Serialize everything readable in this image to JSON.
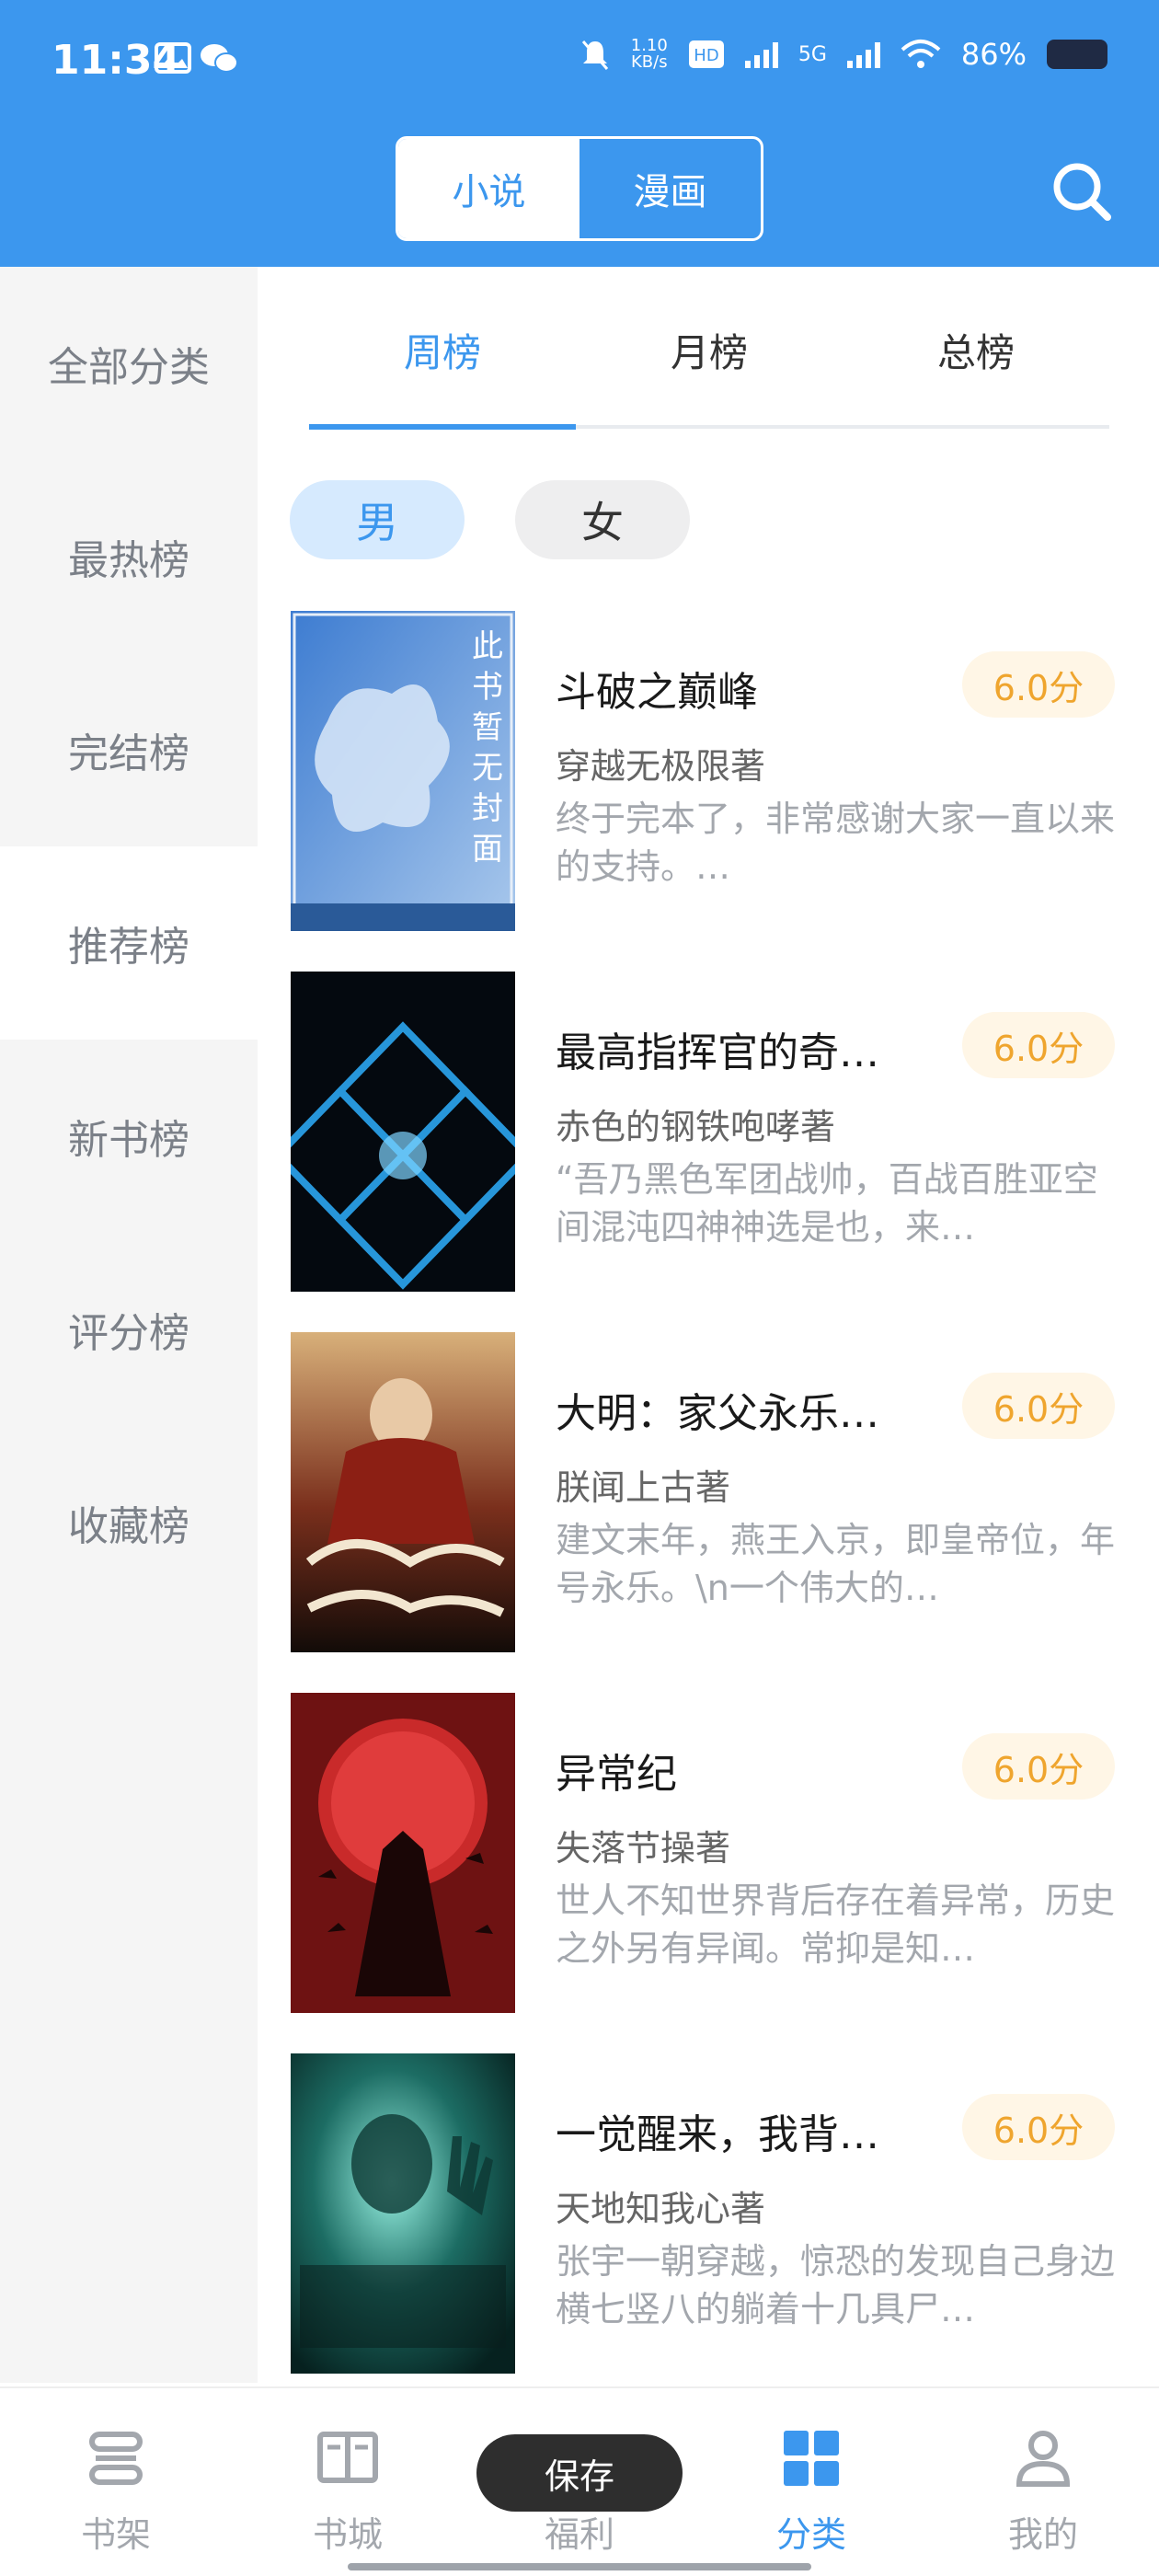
{
  "status_bar": {
    "time": "11:34",
    "network": "5G",
    "battery": "86%"
  },
  "header": {
    "segment": {
      "novel": "小说",
      "comic": "漫画",
      "selected": "小说"
    },
    "search_icon": "search-icon",
    "background": "#3c97ee"
  },
  "sidebar": {
    "items": [
      {
        "label": "全部分类"
      },
      {
        "label": "最热榜"
      },
      {
        "label": "完结榜"
      },
      {
        "label": "推荐榜"
      },
      {
        "label": "新书榜"
      },
      {
        "label": "评分榜"
      },
      {
        "label": "收藏榜"
      }
    ],
    "selected": "推荐榜"
  },
  "rank_tabs": {
    "items": [
      "周榜",
      "月榜",
      "总榜"
    ],
    "selected": "周榜"
  },
  "gender": {
    "male": "男",
    "female": "女",
    "selected": "男"
  },
  "books": [
    {
      "title": "斗破之巅峰",
      "score": "6.0分",
      "author": "穿越无极限著",
      "desc": "终于完本了，非常感谢大家一直以来的支持。…",
      "cover_text": "此书暂无封面"
    },
    {
      "title": "最高指挥官的奇…",
      "score": "6.0分",
      "author": "赤色的钢铁咆哮著",
      "desc": "“吾乃黑色军团战帅，百战百胜亚空间混沌四神神选是也，来…"
    },
    {
      "title": "大明：家父永乐…",
      "score": "6.0分",
      "author": "朕闻上古著",
      "desc": "建文末年，燕王入京，即皇帝位，年号永乐。\\n一个伟大的…"
    },
    {
      "title": "异常纪",
      "score": "6.0分",
      "author": "失落节操著",
      "desc": "世人不知世界背后存在着异常，历史之外另有异闻。常抑是知…"
    },
    {
      "title": "一觉醒来，我背…",
      "score": "6.0分",
      "author": "天地知我心著",
      "desc": "张宇一朝穿越，惊恐的发现自己身边横七竖八的躺着十几具尸…"
    }
  ],
  "bottom_nav": {
    "items": [
      {
        "label": "书架",
        "icon": "bookshelf-icon"
      },
      {
        "label": "书城",
        "icon": "book-open-icon"
      },
      {
        "label": "福利",
        "icon": "gift-icon"
      },
      {
        "label": "分类",
        "icon": "grid-icon"
      },
      {
        "label": "我的",
        "icon": "user-icon"
      }
    ],
    "selected": "分类"
  },
  "toast": "保存",
  "colors": {
    "accent": "#3c97ee",
    "score": "#efa52e",
    "score_bg": "#fff6e6"
  }
}
